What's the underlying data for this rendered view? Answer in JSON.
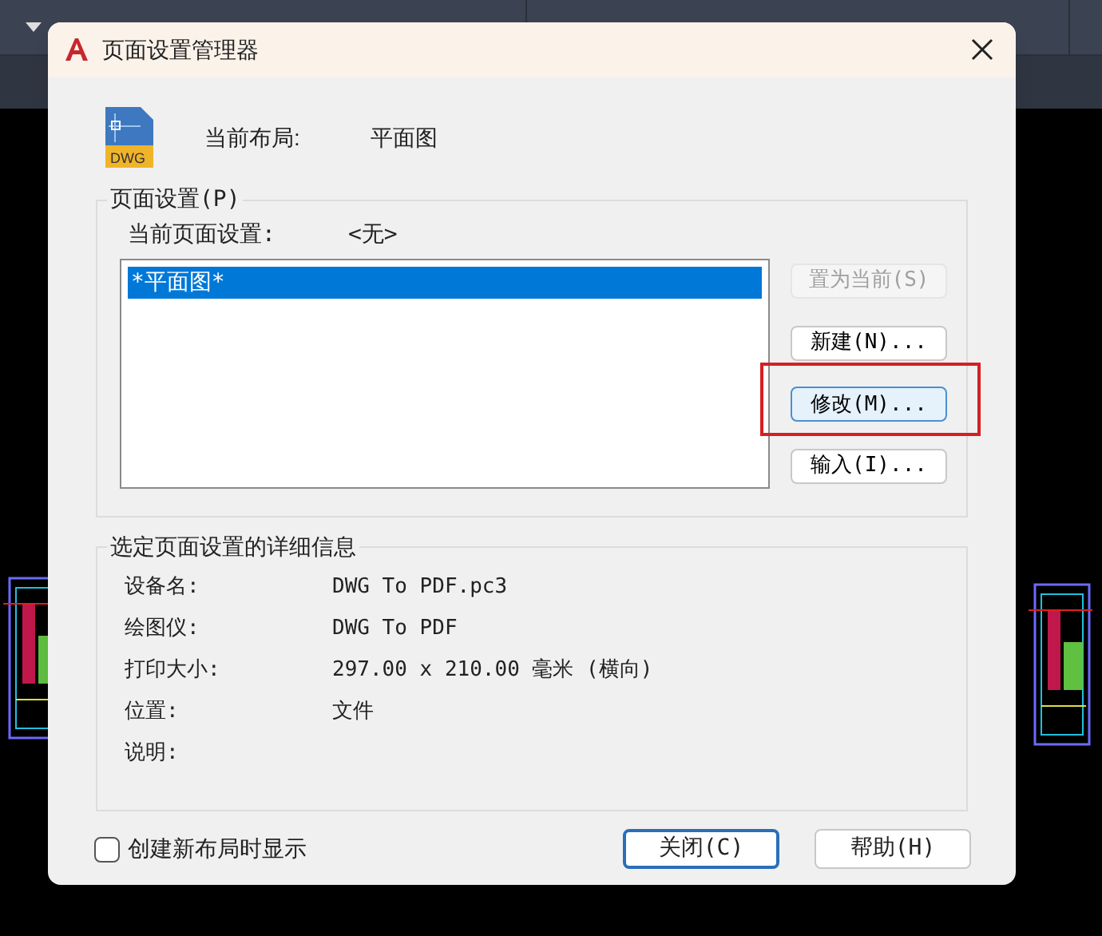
{
  "window": {
    "title": "页面设置管理器"
  },
  "file_icon": {
    "text": "DWG"
  },
  "current_layout": {
    "label": "当前布局:",
    "value": "平面图"
  },
  "page_setups": {
    "group_title": "页面设置(P)",
    "current_label": "当前页面设置:",
    "current_value": "<无>",
    "items": [
      {
        "label": "*平面图*",
        "selected": true
      }
    ],
    "buttons": [
      {
        "label": "置为当前(S)",
        "disabled": true,
        "highlighted": false
      },
      {
        "label": "新建(N)...",
        "disabled": false,
        "highlighted": false
      },
      {
        "label": "修改(M)...",
        "disabled": false,
        "highlighted": true
      },
      {
        "label": "输入(I)...",
        "disabled": false,
        "highlighted": false
      }
    ]
  },
  "details": {
    "group_title": "选定页面设置的详细信息",
    "rows": [
      {
        "label": "设备名:",
        "value": "DWG To PDF.pc3"
      },
      {
        "label": "绘图仪:",
        "value": "DWG To PDF"
      },
      {
        "label": "打印大小:",
        "value": "297.00 x 210.00 毫米 (横向)"
      },
      {
        "label": "位置:",
        "value": "文件"
      },
      {
        "label": "说明:",
        "value": ""
      }
    ]
  },
  "show_on_new_layout": {
    "label": "创建新布局时显示",
    "checked": false
  },
  "buttons": [
    {
      "label": "关闭(C)",
      "default": true
    },
    {
      "label": "帮助(H)",
      "default": false
    }
  ]
}
